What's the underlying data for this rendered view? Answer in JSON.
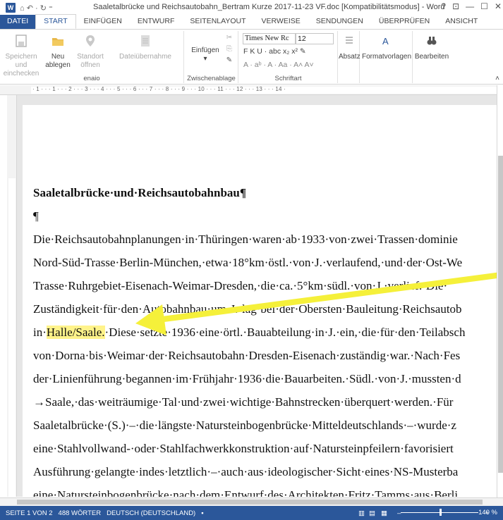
{
  "window": {
    "title": "Saaletalbrücke und Reichsautobahn_Bertram Kurze 2017-11-23 VF.doc [Kompatibilitätsmodus] - Word",
    "app_icon_letter": "W",
    "quick_access": "⌂ ↶ · ↻ ⁼",
    "controls": {
      "help": "?",
      "ribbon_opts": "⊡",
      "minimize": "—",
      "maximize": "☐",
      "close": "✕"
    }
  },
  "tabs": [
    {
      "label": "DATEI"
    },
    {
      "label": "START"
    },
    {
      "label": "EINFÜGEN"
    },
    {
      "label": "ENTWURF"
    },
    {
      "label": "SEITENLAYOUT"
    },
    {
      "label": "VERWEISE"
    },
    {
      "label": "SENDUNGEN"
    },
    {
      "label": "ÜBERPRÜFEN"
    },
    {
      "label": "ANSICHT"
    }
  ],
  "ribbon": {
    "enaio": {
      "save": "Speichern und einchecken",
      "new": "Neu ablegen",
      "location": "Standort öffnen",
      "file_upload": "Dateiübernahme",
      "group_label": "enaio"
    },
    "clipboard": {
      "paste": "Einfügen",
      "group_label": "Zwischenablage"
    },
    "font": {
      "font_name": "Times New Rc",
      "font_size": "12",
      "row2": "F  K  U · abc  x₂  x²  ✎",
      "row3": "A · aᵇ · A · Aa · A˄ A˅",
      "group_label": "Schriftart"
    },
    "paragraph": {
      "label": "Absatz"
    },
    "styles": {
      "label": "Formatvorlagen"
    },
    "editing": {
      "label": "Bearbeiten"
    }
  },
  "ruler": {
    "text": "· 1 · · · 1 · · · 2 · · · 3 · · · 4 · · · 5 · · · 6 · · · 7 · · · 8 · · · 9 · · · 10 · · · 11 · · · 12 · · · 13 · · · 14 ·"
  },
  "document": {
    "lines": [
      "Saaletalbrücke·und·Reichsautobahnbau¶",
      "¶",
      "Die·Reichsautobahnplanungen·in·Thüringen·waren·ab·1933·von·zwei·Trassen·dominie",
      "Nord-Süd-Trasse·Berlin-München,·etwa·18°km·östl.·von·J.·verlaufend,·und·der·Ost-We",
      "Trasse·Ruhrgebiet-Eisenach-Weimar-Dresden,·die·ca.·5°km·südl.·von·J.·verlief.·Die·",
      "Zuständigkeit·für·den·Autobahnbau·um·J.·lag·bei·der·Obersten·Bauleitung·Reichsautob"
    ],
    "line_hl_prefix": "in·",
    "line_hl": "Halle/Saale.",
    "line_hl_rest": "·Diese·setzte·1936·eine·örtl.·Bauabteilung·in·J.·ein,·die·für·den·Teilabsch",
    "lines_after": [
      "von·Dorna·bis·Weimar·der·Reichsautobahn·Dresden-Eisenach·zuständig·war.·Nach·Fes",
      "der·Linienführung·begannen·im·Frühjahr·1936·die·Bauarbeiten.·Südl.·von·J.·mussten·d",
      "→Saale,·das·weiträumige·Tal·und·zwei·wichtige·Bahnstrecken·überquert·werden.·Für",
      "Saaletalbrücke·(S.)·–·die·längste·Natursteinbogenbrücke·Mitteldeutschlands·–·wurde·z",
      "eine·Stahlvollwand-·oder·Stahlfachwerkkonstruktion·auf·Natursteinpfeilern·favorisiert",
      "Ausführung·gelangte·indes·letztlich·–·auch·aus·ideologischer·Sicht·eines·NS-Musterba",
      "eine·Natursteinbogenbrücke·nach·dem·Entwurf·des·Architekten·Fritz·Tamms·aus·Berli"
    ]
  },
  "annotation": {
    "arrow_color": "#f5f03a"
  },
  "status": {
    "page": "SEITE 1 VON 2",
    "words": "488 WÖRTER",
    "language": "DEUTSCH (DEUTSCHLAND)",
    "zoom": "140 %",
    "zoom_minus": "–",
    "zoom_plus": "+"
  },
  "colors": {
    "accent": "#2b579a",
    "highlight": "#fff38a"
  }
}
